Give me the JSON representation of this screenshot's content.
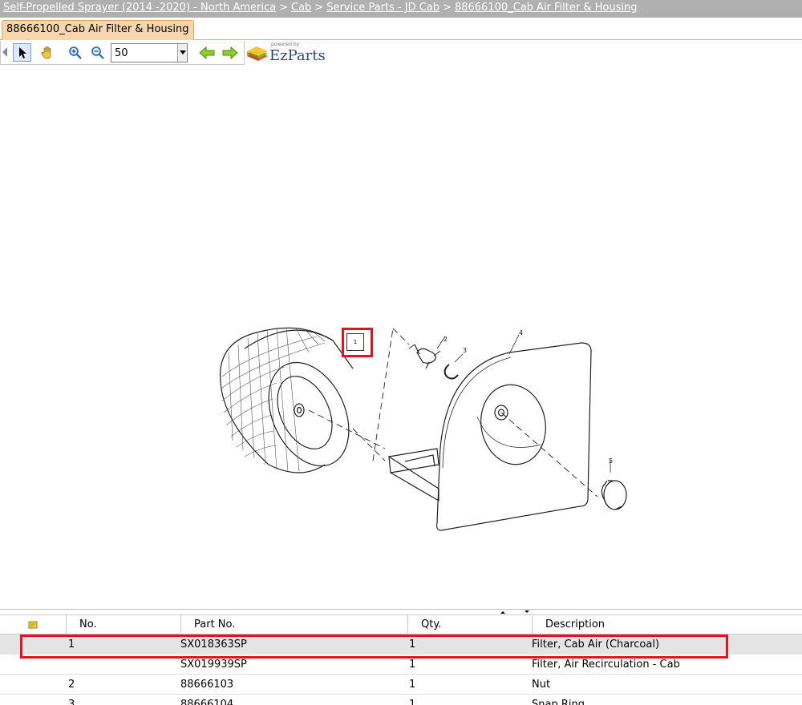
{
  "breadcrumb": {
    "items": [
      "Self-Propelled Sprayer (2014 -2020) - North America",
      "Cab",
      "Service Parts - JD Cab",
      "88666100_Cab Air Filter & Housing"
    ],
    "separator": ">"
  },
  "tab": {
    "label": "88666100_Cab Air Filter & Housing"
  },
  "toolbar": {
    "zoom_value": "50",
    "logo_powered": "powered by",
    "logo_brand": "EzParts"
  },
  "drawing": {
    "callouts": [
      "1",
      "2",
      "3",
      "4",
      "5"
    ]
  },
  "table": {
    "headers": {
      "no": "No.",
      "part_no": "Part No.",
      "qty": "Qty.",
      "description": "Description"
    },
    "rows": [
      {
        "no": "1",
        "part_no": "SX018363SP",
        "qty": "1",
        "description": "Filter, Cab Air (Charcoal)",
        "selected": true
      },
      {
        "no": "",
        "part_no": "SX019939SP",
        "qty": "1",
        "description": "Filter, Air Recirculation - Cab",
        "selected": false
      },
      {
        "no": "2",
        "part_no": "88666103",
        "qty": "1",
        "description": "Nut",
        "selected": false
      },
      {
        "no": "3",
        "part_no": "88666104",
        "qty": "1",
        "description": "Snap Ring",
        "selected": false
      }
    ]
  },
  "colors": {
    "highlight": "#e0141e",
    "tab_bg": "#f7d6ad",
    "breadcrumb_bg": "#b0b0b0"
  }
}
